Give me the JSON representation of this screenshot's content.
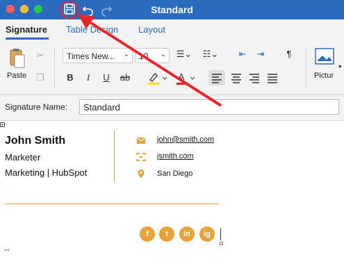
{
  "window": {
    "title": "Standard",
    "icons": [
      "save-icon",
      "undo-icon",
      "redo-icon"
    ]
  },
  "ribbon": {
    "tabs": [
      {
        "label": "Signature",
        "active": true
      },
      {
        "label": "Table Design",
        "active": false
      },
      {
        "label": "Layout",
        "active": false
      }
    ],
    "clipboard": {
      "paste_label": "Paste"
    },
    "font": {
      "family": "Times New...",
      "size": "10"
    },
    "format_glyphs": {
      "bold": "B",
      "italic": "I",
      "underline": "U",
      "strike": "ab",
      "font_color": "A",
      "pilcrow": "¶"
    },
    "picture_label": "Pictur"
  },
  "signature_name": {
    "label": "Signature Name:",
    "value": "Standard"
  },
  "signature": {
    "name": "John Smith",
    "title": "Marketer",
    "company": "Marketing | HubSpot",
    "email": "john@smith.com",
    "website": "jsmith.com",
    "location": "San Diego",
    "social": [
      "f",
      "t",
      "in",
      "ig"
    ],
    "separator": "--"
  },
  "colors": {
    "accent_blue": "#2b6bbf",
    "accent_orange": "#e8a23a",
    "annotation_red": "#e8262d"
  }
}
